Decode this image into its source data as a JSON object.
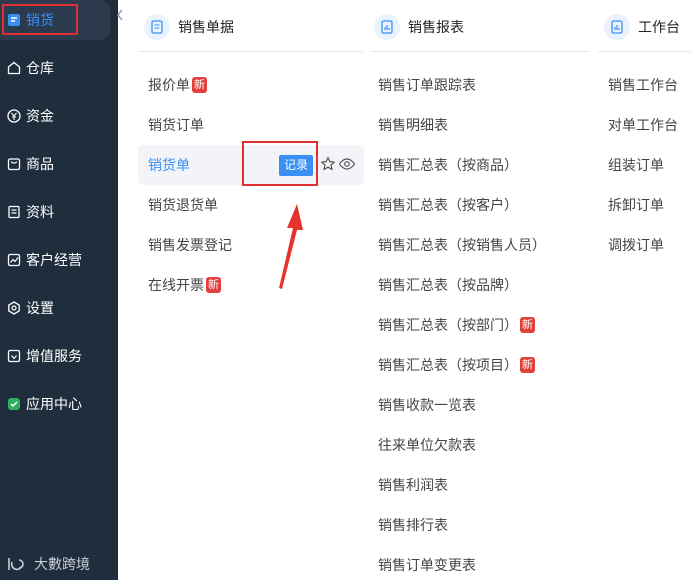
{
  "sidebar": {
    "items": [
      {
        "label": "销货",
        "icon": "sales-doc-icon"
      },
      {
        "label": "仓库",
        "icon": "warehouse-icon"
      },
      {
        "label": "资金",
        "icon": "yen-coin-icon"
      },
      {
        "label": "商品",
        "icon": "goods-bag-icon"
      },
      {
        "label": "资料",
        "icon": "document-icon"
      },
      {
        "label": "客户经营",
        "icon": "trend-chart-icon"
      },
      {
        "label": "设置",
        "icon": "settings-icon"
      },
      {
        "label": "增值服务",
        "icon": "value-added-icon"
      },
      {
        "label": "应用中心",
        "icon": "app-center-icon"
      }
    ],
    "logo_text": "大數跨境",
    "colors": {
      "bg": "#1f2d3d",
      "active_text": "#3a8ff5",
      "highlight_frame": "#e03030"
    }
  },
  "columns": [
    {
      "header": "销售单据",
      "icon": "document-icon",
      "items": [
        {
          "label": "报价单",
          "badge": "新"
        },
        {
          "label": "销货订单"
        },
        {
          "label": "销货单",
          "active": true
        },
        {
          "label": "销货退货单"
        },
        {
          "label": "销售发票登记"
        },
        {
          "label": "在线开票",
          "badge": "新"
        }
      ]
    },
    {
      "header": "销售报表",
      "icon": "report-chart-icon",
      "items": [
        {
          "label": "销售订单跟踪表"
        },
        {
          "label": "销售明细表"
        },
        {
          "label": "销售汇总表（按商品）"
        },
        {
          "label": "销售汇总表（按客户）"
        },
        {
          "label": "销售汇总表（按销售人员）"
        },
        {
          "label": "销售汇总表（按品牌）"
        },
        {
          "label": "销售汇总表（按部门）",
          "badge": "新"
        },
        {
          "label": "销售汇总表（按项目）",
          "badge": "新"
        },
        {
          "label": "销售收款一览表"
        },
        {
          "label": "往来单位欠款表"
        },
        {
          "label": "销售利润表"
        },
        {
          "label": "销售排行表"
        },
        {
          "label": "销售订单变更表"
        }
      ]
    },
    {
      "header": "工作台",
      "icon": "report-chart-icon",
      "items": [
        {
          "label": "销售工作台"
        },
        {
          "label": "对单工作台"
        },
        {
          "label": "组装订单"
        },
        {
          "label": "拆卸订单"
        },
        {
          "label": "调拨订单"
        }
      ]
    }
  ],
  "row_actions": {
    "record_label": "记录",
    "star_icon": "star-icon",
    "eye_icon": "eye-icon"
  },
  "badge_color": "#e2403c",
  "accent": "#3a8ff5"
}
